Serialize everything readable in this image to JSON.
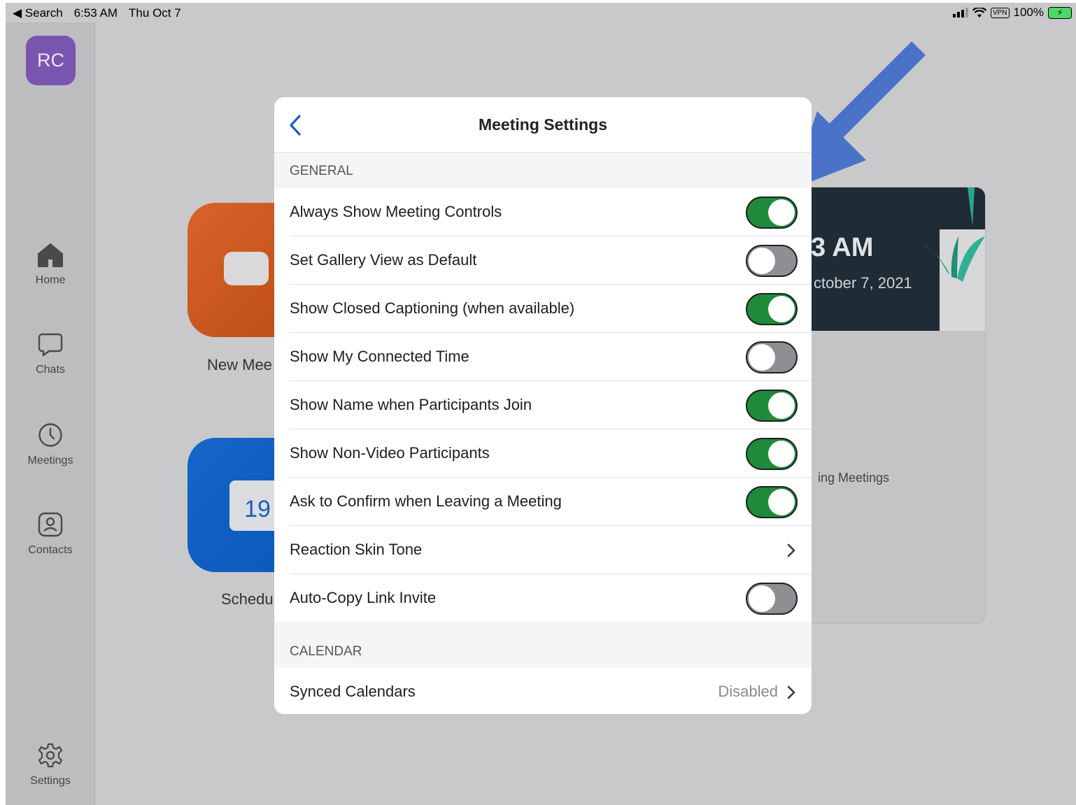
{
  "status_bar": {
    "back_app": "◀ Search",
    "time": "6:53 AM",
    "date": "Thu Oct 7",
    "vpn": "VPN",
    "battery": "100%"
  },
  "sidebar": {
    "avatar_initials": "RC",
    "items": [
      {
        "label": "Home",
        "icon": "home-icon"
      },
      {
        "label": "Chats",
        "icon": "chat-bubble-icon"
      },
      {
        "label": "Meetings",
        "icon": "clock-icon"
      },
      {
        "label": "Contacts",
        "icon": "contact-card-icon"
      },
      {
        "label": "Settings",
        "icon": "gear-icon"
      }
    ]
  },
  "background": {
    "new_meeting_label": "New Mee",
    "schedule_label": "Schedu",
    "calendar_day": "19",
    "clock_time": "3 AM",
    "clock_date": "ctober 7, 2021",
    "upcoming_text": "ing Meetings"
  },
  "modal": {
    "title": "Meeting Settings",
    "sections": [
      {
        "header": "GENERAL",
        "rows": [
          {
            "label": "Always Show Meeting Controls",
            "type": "toggle",
            "on": true
          },
          {
            "label": "Set Gallery View as Default",
            "type": "toggle",
            "on": false
          },
          {
            "label": "Show Closed Captioning (when available)",
            "type": "toggle",
            "on": true
          },
          {
            "label": "Show My Connected Time",
            "type": "toggle",
            "on": false
          },
          {
            "label": "Show Name when Participants Join",
            "type": "toggle",
            "on": true
          },
          {
            "label": "Show Non-Video Participants",
            "type": "toggle",
            "on": true
          },
          {
            "label": "Ask to Confirm when Leaving a Meeting",
            "type": "toggle",
            "on": true
          },
          {
            "label": "Reaction Skin Tone",
            "type": "disclosure"
          },
          {
            "label": "Auto-Copy Link Invite",
            "type": "toggle",
            "on": false
          }
        ]
      },
      {
        "header": "CALENDAR",
        "rows": [
          {
            "label": "Synced Calendars",
            "type": "disclosure",
            "value": "Disabled"
          }
        ]
      }
    ]
  },
  "colors": {
    "toggle_on": "#1f8a3a",
    "toggle_off": "#8e8e93",
    "annotation_arrow": "#4a72c9",
    "back_chevron": "#1a5fb8"
  }
}
